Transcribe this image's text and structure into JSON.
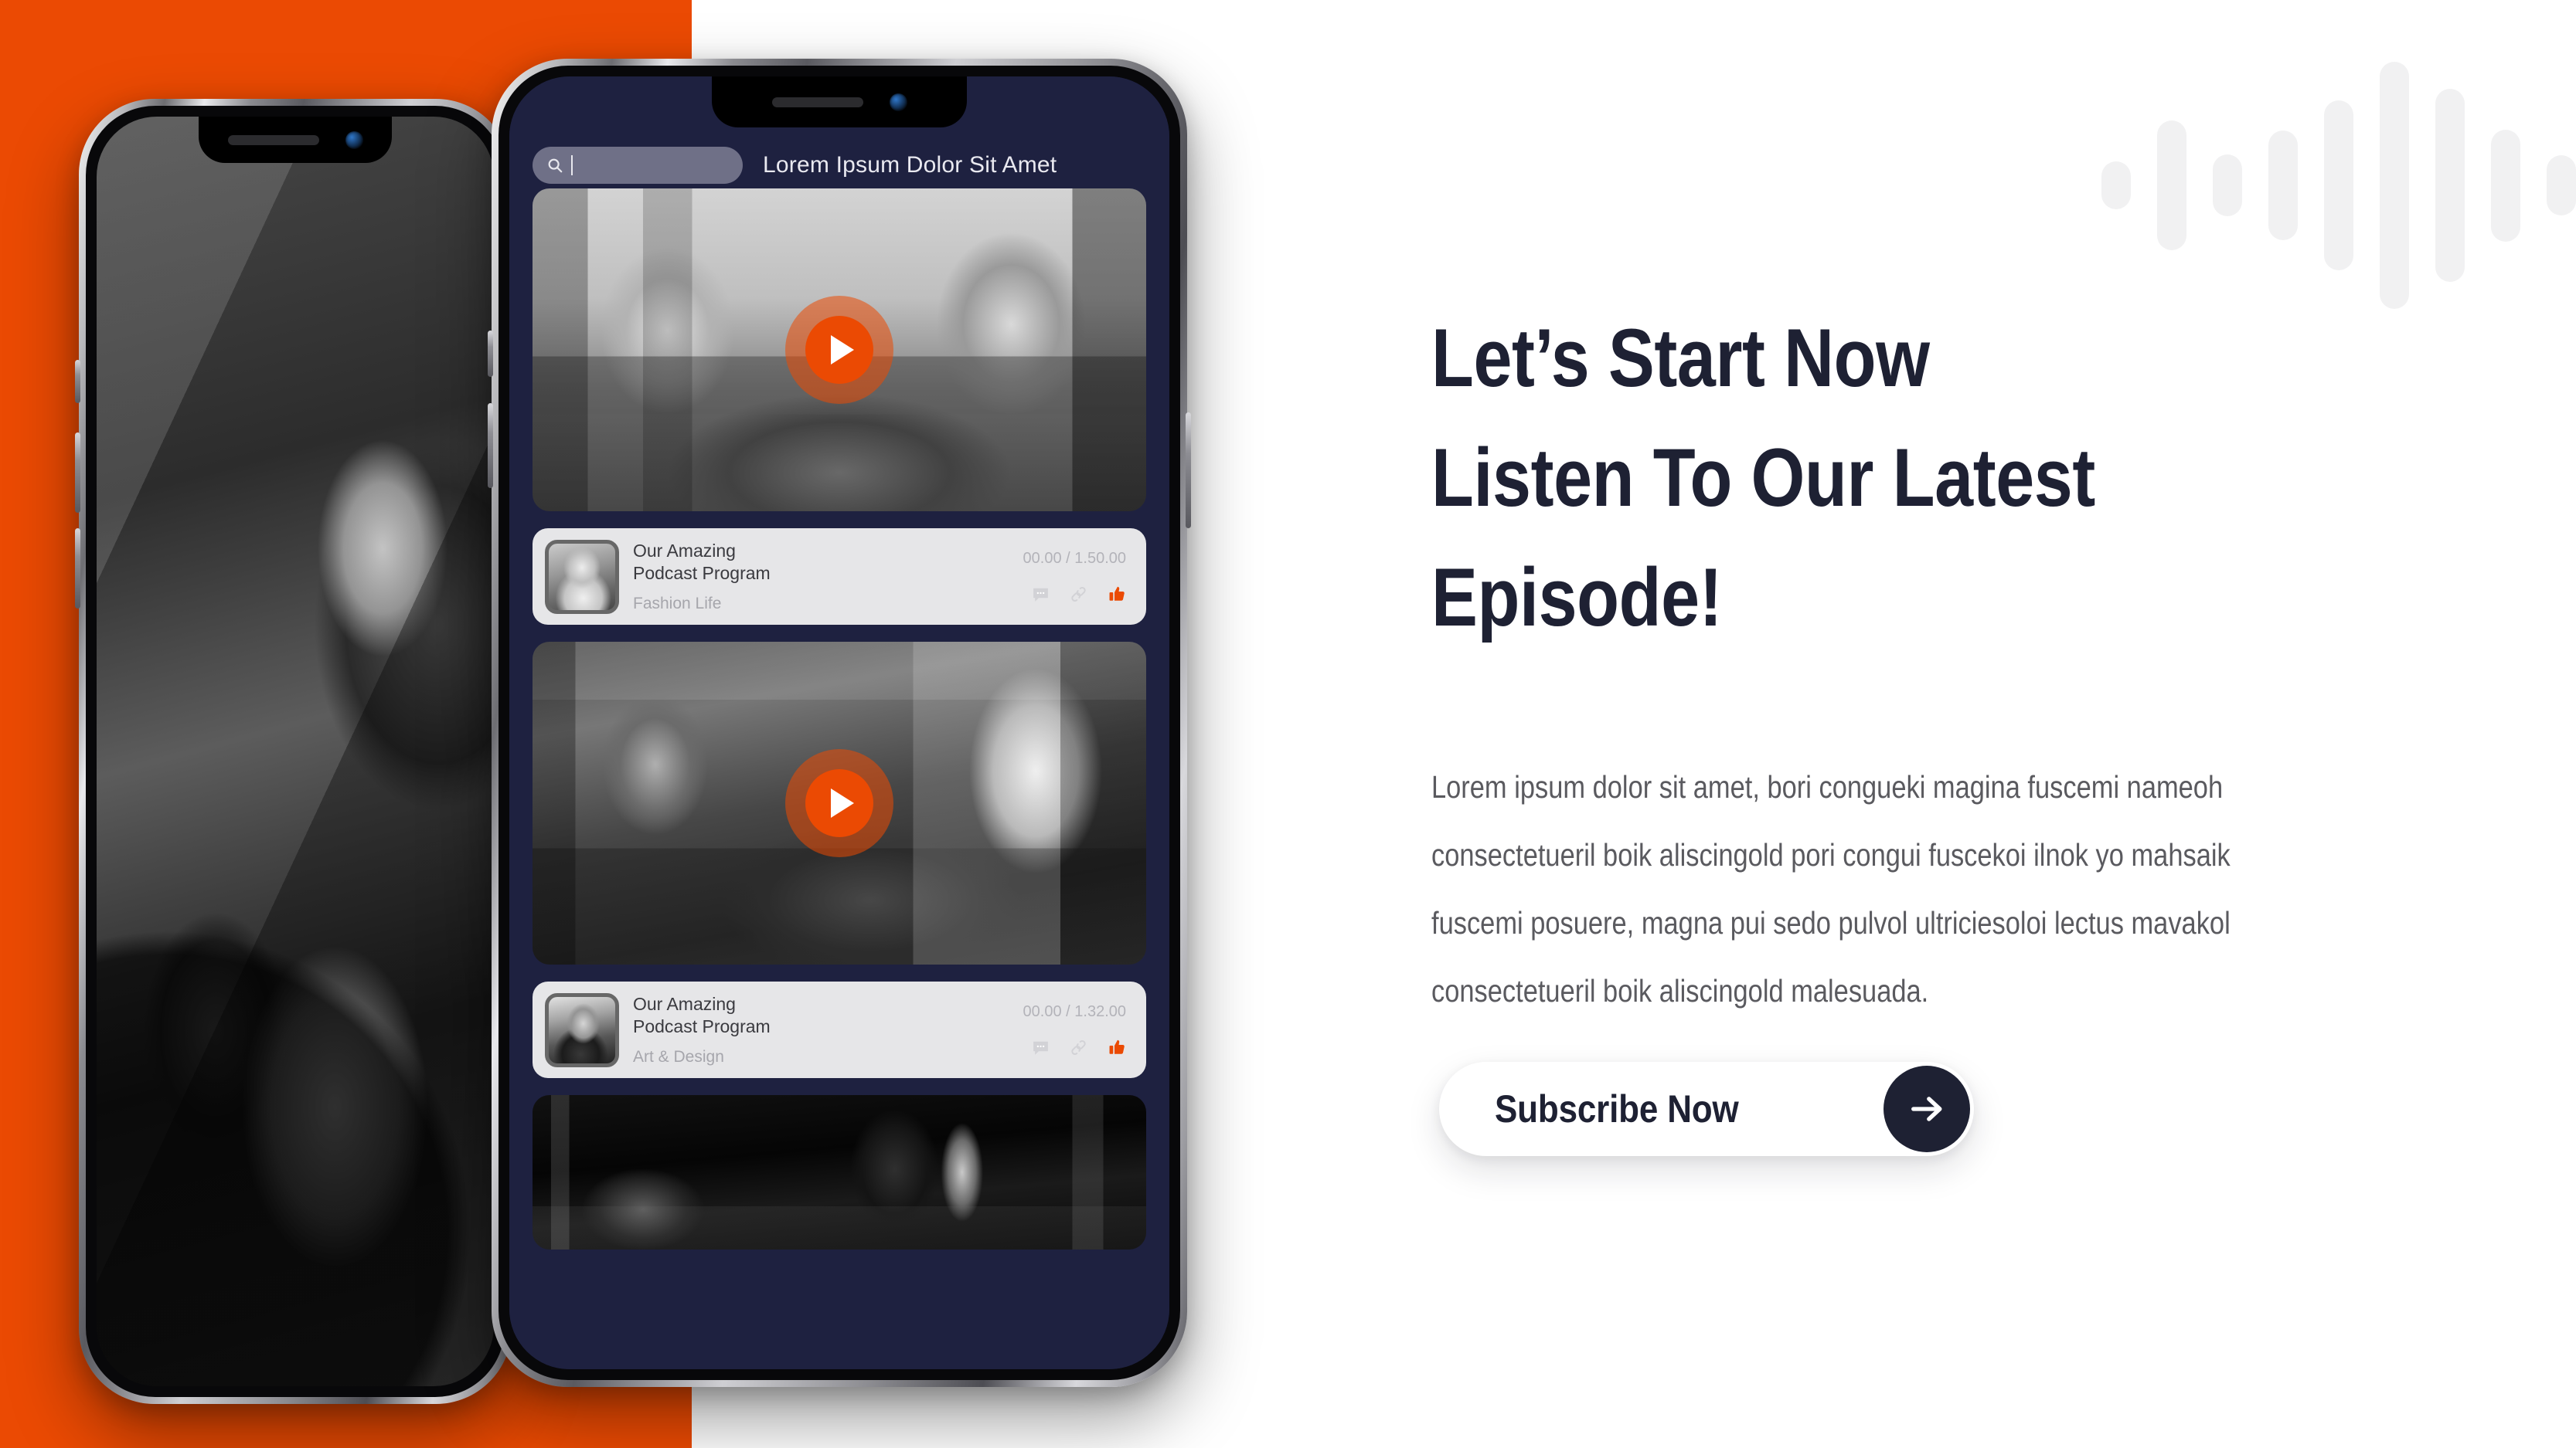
{
  "theme": {
    "orange": "#eb4a03",
    "navy": "#1e2133",
    "app_bg": "#1e2140",
    "card_bg": "#e6e6e8",
    "wave_color": "#f1f1f2"
  },
  "decor": {
    "waveform_name": "audio-waveform",
    "waveform_bars": [
      62,
      168,
      80,
      142,
      220,
      320,
      250,
      145,
      78
    ]
  },
  "phone_left": {
    "name": "phone-mockup-back",
    "photo_alt": "Woman laughing at podcast microphone"
  },
  "app": {
    "search": {
      "placeholder": "",
      "value": "",
      "icon": "search-icon"
    },
    "title": "Lorem Ipsum Dolor Sit Amet",
    "cards": [
      {
        "thumb": "thumb-a",
        "photo_alt": "Two women recording a podcast in a living room",
        "play_label": "Play"
      },
      {
        "thumb": "thumb-b",
        "photo_alt": "Two men recording a podcast at a desk",
        "play_label": "Play"
      },
      {
        "thumb": "thumb-c",
        "photo_alt": "Studio microphone with pop filter",
        "play_label": "Play"
      }
    ],
    "episodes": [
      {
        "title_line1": "Our Amazing",
        "title_line2": "Podcast Program",
        "category": "Fashion Life",
        "time": "00.00 / 1.50.00",
        "avatar": "female",
        "actions": [
          "comment-icon",
          "link-icon",
          "thumbs-up-icon"
        ]
      },
      {
        "title_line1": "Our Amazing",
        "title_line2": "Podcast Program",
        "category": "Art & Design",
        "time": "00.00 / 1.32.00",
        "avatar": "male",
        "actions": [
          "comment-icon",
          "link-icon",
          "thumbs-up-icon"
        ]
      }
    ]
  },
  "content": {
    "headline_line1": "Let’s Start Now",
    "headline_line2": "Listen To Our Latest",
    "headline_line3": "Episode!",
    "paragraph": "Lorem ipsum dolor sit amet, bori congueki magina fuscemi nameoh consectetueril boik aliscingold pori congui fuscekoi ilnok yo mahsaik fuscemi posuere, magna pui sedo pulvol ultriciesoloi lectus mavakol consectetueril boik aliscingold malesuada.",
    "cta_label": "Subscribe Now",
    "cta_icon": "arrow-right-icon"
  }
}
